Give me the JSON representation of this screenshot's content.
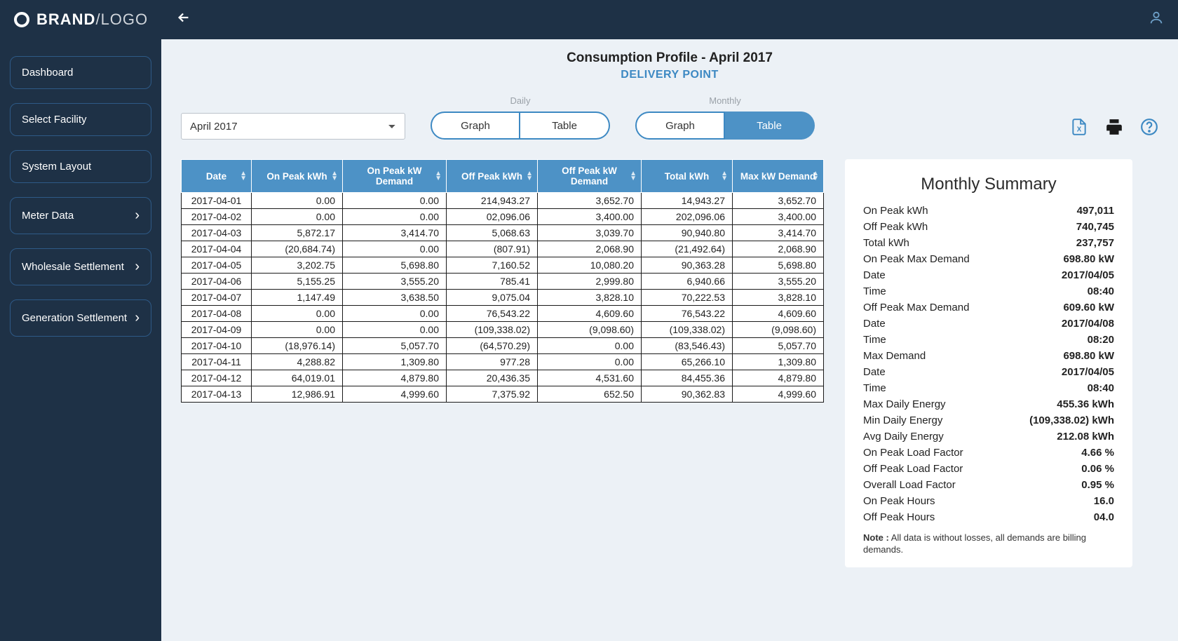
{
  "brand": {
    "primary": "BRAND",
    "secondary": "/LOGO"
  },
  "sidebar": {
    "items": [
      {
        "label": "Dashboard",
        "expandable": false
      },
      {
        "label": "Select Facility",
        "expandable": false
      },
      {
        "label": "System Layout",
        "expandable": false
      },
      {
        "label": "Meter Data",
        "expandable": true
      },
      {
        "label": "Wholesale Settlement",
        "expandable": true
      },
      {
        "label": "Generation Settlement",
        "expandable": true
      }
    ]
  },
  "page": {
    "title": "Consumption Profile - April 2017",
    "subtitle": "DELIVERY POINT"
  },
  "toolbar": {
    "period": "April 2017",
    "daily_label": "Daily",
    "monthly_label": "Monthly",
    "graph_label": "Graph",
    "table_label": "Table"
  },
  "table": {
    "columns": [
      "Date",
      "On Peak kWh",
      "On Peak kW Demand",
      "Off Peak kWh",
      "Off Peak kW Demand",
      "Total kWh",
      "Max kW Demand"
    ],
    "rows": [
      [
        "2017-04-01",
        "0.00",
        "0.00",
        "214,943.27",
        "3,652.70",
        "14,943.27",
        "3,652.70"
      ],
      [
        "2017-04-02",
        "0.00",
        "0.00",
        "02,096.06",
        "3,400.00",
        "202,096.06",
        "3,400.00"
      ],
      [
        "2017-04-03",
        "5,872.17",
        "3,414.70",
        "5,068.63",
        "3,039.70",
        "90,940.80",
        "3,414.70"
      ],
      [
        "2017-04-04",
        "(20,684.74)",
        "0.00",
        "(807.91)",
        "2,068.90",
        "(21,492.64)",
        "2,068.90"
      ],
      [
        "2017-04-05",
        "3,202.75",
        "5,698.80",
        "7,160.52",
        "10,080.20",
        "90,363.28",
        "5,698.80"
      ],
      [
        "2017-04-06",
        "5,155.25",
        "3,555.20",
        "785.41",
        "2,999.80",
        "6,940.66",
        "3,555.20"
      ],
      [
        "2017-04-07",
        "1,147.49",
        "3,638.50",
        "9,075.04",
        "3,828.10",
        "70,222.53",
        "3,828.10"
      ],
      [
        "2017-04-08",
        "0.00",
        "0.00",
        "76,543.22",
        "4,609.60",
        "76,543.22",
        "4,609.60"
      ],
      [
        "2017-04-09",
        "0.00",
        "0.00",
        "(109,338.02)",
        "(9,098.60)",
        "(109,338.02)",
        "(9,098.60)"
      ],
      [
        "2017-04-10",
        "(18,976.14)",
        "5,057.70",
        "(64,570.29)",
        "0.00",
        "(83,546.43)",
        "5,057.70"
      ],
      [
        "2017-04-11",
        "4,288.82",
        "1,309.80",
        "977.28",
        "0.00",
        "65,266.10",
        "1,309.80"
      ],
      [
        "2017-04-12",
        "64,019.01",
        "4,879.80",
        "20,436.35",
        "4,531.60",
        "84,455.36",
        "4,879.80"
      ],
      [
        "2017-04-13",
        "12,986.91",
        "4,999.60",
        "7,375.92",
        "652.50",
        "90,362.83",
        "4,999.60"
      ]
    ]
  },
  "summary": {
    "title": "Monthly Summary",
    "items": [
      {
        "label": "On Peak kWh",
        "value": "497,011"
      },
      {
        "label": "Off Peak kWh",
        "value": "740,745"
      },
      {
        "label": "Total kWh",
        "value": "237,757"
      },
      {
        "label": "On Peak Max Demand",
        "value": "698.80 kW"
      },
      {
        "label": "Date",
        "value": "2017/04/05"
      },
      {
        "label": "Time",
        "value": "08:40"
      },
      {
        "label": "Off Peak Max Demand",
        "value": "609.60 kW"
      },
      {
        "label": "Date",
        "value": "2017/04/08"
      },
      {
        "label": "Time",
        "value": "08:20"
      },
      {
        "label": "Max Demand",
        "value": "698.80 kW"
      },
      {
        "label": "Date",
        "value": "2017/04/05"
      },
      {
        "label": "Time",
        "value": "08:40"
      },
      {
        "label": "Max Daily Energy",
        "value": "455.36 kWh"
      },
      {
        "label": "Min Daily Energy",
        "value": "(109,338.02) kWh"
      },
      {
        "label": "Avg Daily Energy",
        "value": "212.08 kWh"
      },
      {
        "label": "On Peak Load Factor",
        "value": "4.66 %"
      },
      {
        "label": "Off Peak Load Factor",
        "value": "0.06 %"
      },
      {
        "label": "Overall Load Factor",
        "value": "0.95 %"
      },
      {
        "label": "On Peak Hours",
        "value": "16.0"
      },
      {
        "label": "Off Peak Hours",
        "value": "04.0"
      }
    ],
    "note_label": "Note :",
    "note_text": " All data is without losses, all demands are billing demands."
  }
}
